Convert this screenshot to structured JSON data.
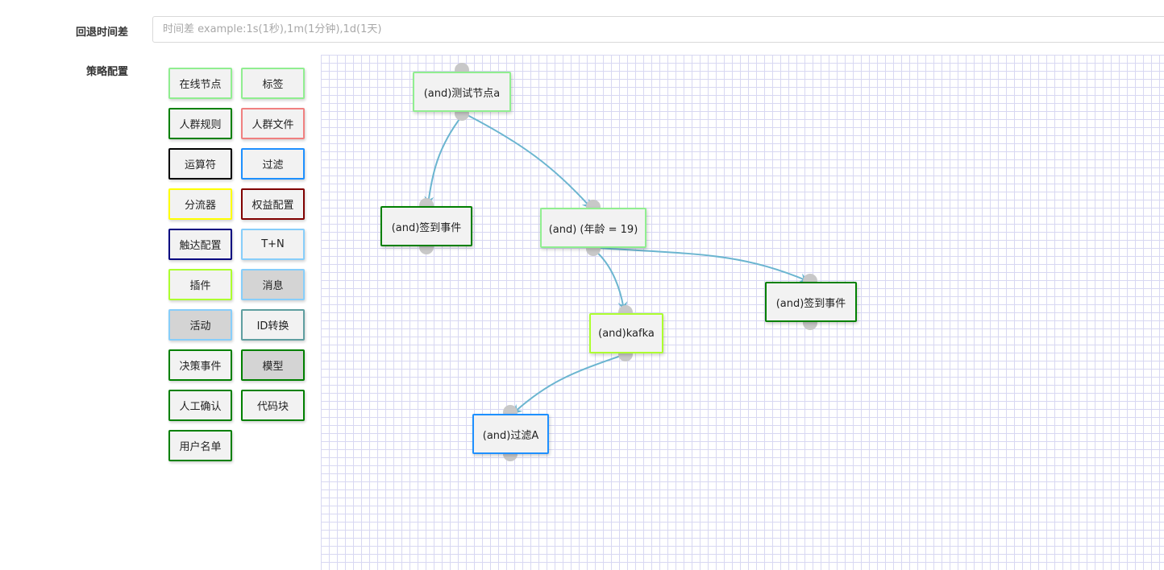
{
  "form": {
    "rollback_label": "回退时间差",
    "rollback_placeholder": "时间差 example:1s(1秒),1m(1分钟),1d(1天)",
    "strategy_label": "策略配置"
  },
  "palette": [
    {
      "label": "在线节点",
      "color": "#90ee90"
    },
    {
      "label": "标签",
      "color": "#90ee90"
    },
    {
      "label": "人群规则",
      "color": "#008000"
    },
    {
      "label": "人群文件",
      "color": "#f08080"
    },
    {
      "label": "运算符",
      "color": "#000000"
    },
    {
      "label": "过滤",
      "color": "#1e90ff"
    },
    {
      "label": "分流器",
      "color": "#ffff00"
    },
    {
      "label": "权益配置",
      "color": "#800000"
    },
    {
      "label": "触达配置",
      "color": "#000080"
    },
    {
      "label": "T+N",
      "color": "#87cefa"
    },
    {
      "label": "插件",
      "color": "#adff2f"
    },
    {
      "label": "消息",
      "color": "#87cefa"
    },
    {
      "label": "活动",
      "color": "#87cefa"
    },
    {
      "label": "ID转换",
      "color": "#5f9ea0"
    },
    {
      "label": "决策事件",
      "color": "#008000"
    },
    {
      "label": "模型",
      "color": "#008000"
    },
    {
      "label": "人工确认",
      "color": "#008000"
    },
    {
      "label": "代码块",
      "color": "#008000"
    },
    {
      "label": "用户名单",
      "color": "#008000"
    }
  ],
  "flow": {
    "edge_color": "#6bb5d0",
    "nodes": [
      {
        "label": "(and)测试节点a",
        "color": "#90ee90"
      },
      {
        "label": "(and)签到事件",
        "color": "#008000"
      },
      {
        "label": "(and) (年龄 = 19)",
        "color": "#90ee90"
      },
      {
        "label": "(and)签到事件",
        "color": "#008000"
      },
      {
        "label": "(and)kafka",
        "color": "#adff2f"
      },
      {
        "label": "(and)过滤A",
        "color": "#1e90ff"
      }
    ]
  }
}
